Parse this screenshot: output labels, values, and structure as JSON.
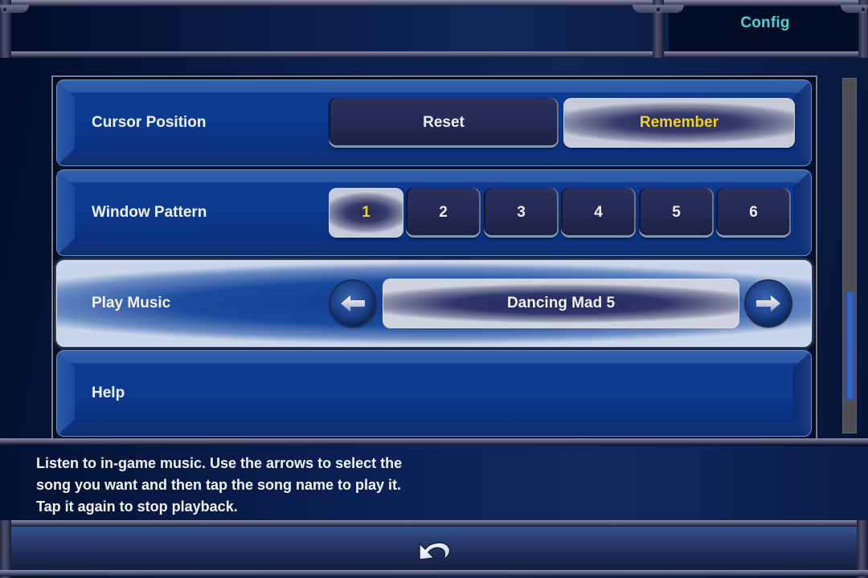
{
  "header": {
    "title": "Config"
  },
  "settings": [
    {
      "label": "Cursor Position",
      "type": "choice",
      "options": [
        "Reset",
        "Remember"
      ],
      "selected": "Remember"
    },
    {
      "label": "Window Pattern",
      "type": "choice",
      "options": [
        "1",
        "2",
        "3",
        "4",
        "5",
        "6"
      ],
      "selected": "1"
    },
    {
      "label": "Play Music",
      "type": "selector",
      "value": "Dancing Mad 5",
      "prev_icon": "arrow-left-icon",
      "next_icon": "arrow-right-icon",
      "selected_row": true
    },
    {
      "label": "Help",
      "type": "link"
    }
  ],
  "scrollbar": {
    "position_fraction": 0.62,
    "visible_fraction": 0.3
  },
  "description": "Listen to in-game music. Use the arrows to select the song you want and then tap the song name to play it. Tap it again to stop playback.",
  "footer": {
    "back_icon": "undo-arrow-icon"
  },
  "colors": {
    "highlight_text": "#f4d11a",
    "title_text": "#4fcfd6",
    "row_blue": "#0c3a8f"
  }
}
